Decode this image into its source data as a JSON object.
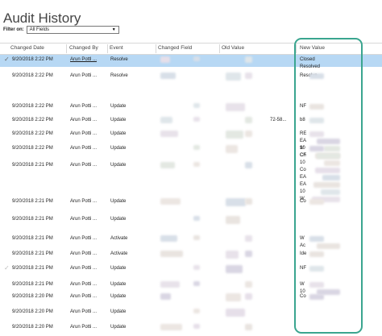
{
  "title": "Audit History",
  "filter": {
    "label": "Filter on:",
    "value": "All Fields"
  },
  "columns": [
    "Changed Date",
    "Changed By",
    "Event",
    "Changed Field",
    "Old Value",
    "New Value"
  ],
  "rows": [
    {
      "date": "9/20/2018 2:22 PM",
      "by": "Arun Pottl ...",
      "event": "Resolve",
      "selected": true,
      "checked": true,
      "new_value": [
        "Closed",
        "Resolved"
      ]
    },
    {
      "date": "9/20/2018 2:22 PM",
      "by": "Arun Potti ...",
      "event": "Resolve",
      "new_value": [
        "Resolve"
      ]
    },
    {
      "date": "9/20/2018 2:22 PM",
      "by": "Arun Potti ...",
      "event": "Update",
      "new_value": [
        "NF"
      ]
    },
    {
      "date": "9/20/2018 2:22 PM",
      "by": "Arun Potti ...",
      "event": "Update",
      "old_value": "72-58...",
      "new_value": [
        "b8"
      ]
    },
    {
      "date": "9/20/2018 2:22 PM",
      "by": "Arun Potti ...",
      "event": "Update",
      "new_value": [
        "RE",
        "EA",
        "10",
        "Ch"
      ]
    },
    {
      "date": "9/20/2018 2:22 PM",
      "by": "Arun Potti ...",
      "event": "Update",
      "new_value": [
        "9/",
        "CF",
        "10",
        "Co",
        "EA",
        "EA",
        "10",
        "W"
      ]
    },
    {
      "date": "9/20/2018 2:21 PM",
      "by": "Arun Potti ...",
      "event": "Update",
      "new_value": []
    },
    {
      "date": "9/20/2018 2:21 PM",
      "by": "Arun Potti ...",
      "event": "Update",
      "new_value": [
        "Co"
      ]
    },
    {
      "date": "9/20/2018 2:21 PM",
      "by": "Arun Potti ...",
      "event": "Update",
      "new_value": []
    },
    {
      "date": "9/20/2018 2:21 PM",
      "by": "Arun Potti ...",
      "event": "Activate",
      "new_value": [
        "W",
        "Ac"
      ]
    },
    {
      "date": "9/20/2018 2:21 PM",
      "by": "Arun Potti ...",
      "event": "Activate",
      "new_value": [
        "Ide"
      ]
    },
    {
      "date": "9/20/2018 2:21 PM",
      "by": "Arun Potti ...",
      "event": "Update",
      "checked_faint": true,
      "new_value": [
        "NF"
      ]
    },
    {
      "date": "9/20/2018 2:21 PM",
      "by": "Arun Potti ...",
      "event": "Update",
      "new_value": [
        "W",
        "10"
      ]
    },
    {
      "date": "9/20/2018 2:20 PM",
      "by": "Arun Potti ...",
      "event": "Update",
      "new_value": [
        "Co"
      ]
    },
    {
      "date": "9/20/2018 2:20 PM",
      "by": "Arun Potti ...",
      "event": "Update",
      "new_value": []
    },
    {
      "date": "9/20/2018 2:20 PM",
      "by": "Arun Potti ...",
      "event": "Update",
      "new_value": []
    }
  ],
  "colors": {
    "selected_row": "#b7d8f4",
    "highlight_border": "#3aa58f",
    "header_text": "#444444"
  }
}
